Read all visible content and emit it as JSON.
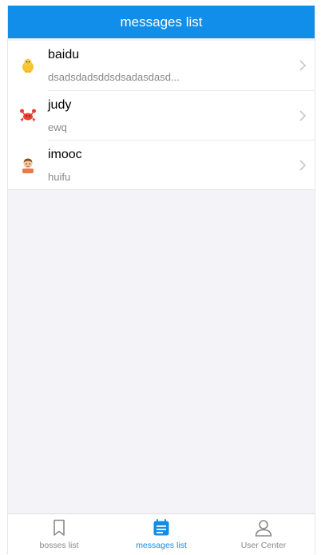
{
  "header": {
    "title": "messages list"
  },
  "messages": [
    {
      "name": "baidu",
      "brief": "dsadsdadsddsdsadasdasd...",
      "avatar_icon": "chick-icon"
    },
    {
      "name": "judy",
      "brief": "ewq",
      "avatar_icon": "crab-icon"
    },
    {
      "name": "imooc",
      "brief": "huifu",
      "avatar_icon": "man-icon"
    }
  ],
  "tabbar": {
    "tabs": [
      {
        "label": "bosses list",
        "icon": "bookmark-icon",
        "active": false
      },
      {
        "label": "messages list",
        "icon": "document-icon",
        "active": true
      },
      {
        "label": "User Center",
        "icon": "user-icon",
        "active": false
      }
    ]
  },
  "colors": {
    "primary": "#108ee9",
    "background": "#f4f4f8",
    "inactive_tab": "#888888"
  }
}
